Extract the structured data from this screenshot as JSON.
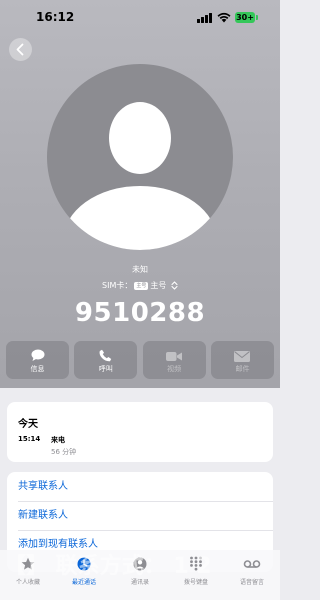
{
  "status_bar": {
    "time": "16:12",
    "battery": "30+"
  },
  "contact": {
    "name": "未知",
    "sim_label": "SIM卡：",
    "sim_badge": "主号",
    "sim_line": "主号",
    "number": "9510288"
  },
  "actions": [
    {
      "label": "信息",
      "icon": "message-icon",
      "enabled": true
    },
    {
      "label": "呼叫",
      "icon": "phone-icon",
      "enabled": true
    },
    {
      "label": "视频",
      "icon": "video-icon",
      "enabled": false
    },
    {
      "label": "邮件",
      "icon": "mail-icon",
      "enabled": false
    }
  ],
  "recents": {
    "title": "今天",
    "time": "15:14",
    "type": "来电",
    "duration": "56 分钟"
  },
  "links": [
    "共享联系人",
    "新建联系人",
    "添加到现有联系人"
  ],
  "tab_bar": [
    {
      "label": "个人收藏",
      "icon": "star-icon",
      "active": false
    },
    {
      "label": "最近通话",
      "icon": "clock-icon",
      "active": true
    },
    {
      "label": "通讯录",
      "icon": "contacts-icon",
      "active": false
    },
    {
      "label": "拨号键盘",
      "icon": "keypad-icon",
      "active": false
    },
    {
      "label": "语音留言",
      "icon": "voicemail-icon",
      "active": false
    }
  ],
  "watermark": "【】 联系方式：    1    2",
  "colors": {
    "accent": "#0a66d8",
    "battery": "#34c759",
    "hero": "#aeaeb4"
  }
}
